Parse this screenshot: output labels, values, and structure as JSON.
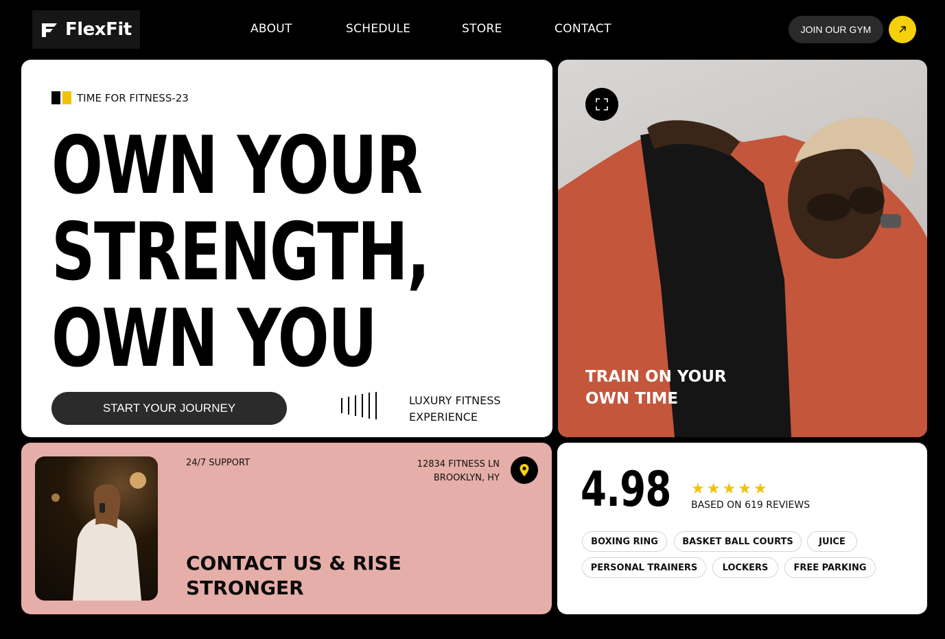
{
  "header": {
    "brand": "FlexFit",
    "nav": [
      {
        "label": "ABOUT"
      },
      {
        "label": "SCHEDULE"
      },
      {
        "label": "STORE"
      },
      {
        "label": "CONTACT"
      }
    ],
    "join_label": "JOIN OUR GYM",
    "accent": "#f6d10b"
  },
  "hero": {
    "tag": "TIME FOR FITNESS-23",
    "headline": [
      "OWN YOUR",
      "STRENGTH,",
      "OWN YOU"
    ],
    "cta": "START YOUR JOURNEY",
    "lux_line1": "LUXURY FITNESS",
    "lux_line2": "EXPERIENCE"
  },
  "photo": {
    "caption_line1": "TRAIN ON YOUR",
    "caption_line2": "OWN TIME"
  },
  "contact": {
    "support": "24/7 SUPPORT",
    "address_line1": "12834 FITNESS LN",
    "address_line2": "BROOKLYN, HY",
    "title_line1": "CONTACT US & RISE",
    "title_line2": "STRONGER",
    "bg_color": "#e6aea8"
  },
  "rating": {
    "score": "4.98",
    "stars": 5,
    "reviews": "BASED ON 619 REVIEWS",
    "amenities": [
      "BOXING RING",
      "BASKET BALL COURTS",
      "JUICE",
      "PERSONAL TRAINERS",
      "LOCKERS",
      "FREE PARKING"
    ]
  }
}
